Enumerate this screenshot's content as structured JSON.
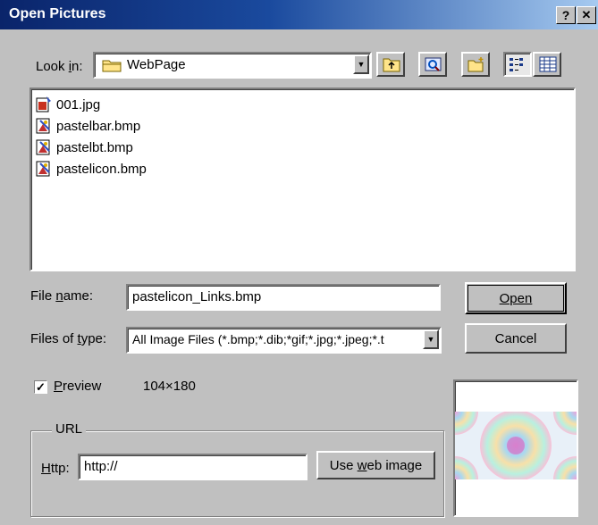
{
  "window": {
    "title": "Open Pictures",
    "help_label": "?",
    "close_label": "✕"
  },
  "lookin": {
    "label": "Look in:",
    "value": "WebPage"
  },
  "files": [
    {
      "name": "001.jpg",
      "icon": "jpg-file-icon"
    },
    {
      "name": "pastelbar.bmp",
      "icon": "bmp-file-icon"
    },
    {
      "name": "pastelbt.bmp",
      "icon": "bmp-file-icon"
    },
    {
      "name": "pastelicon.bmp",
      "icon": "bmp-file-icon"
    }
  ],
  "filename": {
    "label": "File name:",
    "value": "pastelicon_Links.bmp"
  },
  "filetype": {
    "label": "Files of type:",
    "value": "All Image Files (*.bmp;*.dib;*gif;*.jpg;*.jpeg;*.t"
  },
  "buttons": {
    "open": "Open",
    "cancel": "Cancel",
    "use_web_image": "Use web image"
  },
  "preview": {
    "label": "Preview",
    "checked": true,
    "dimensions": "104×180"
  },
  "url": {
    "group_label": "URL",
    "http_label": "Http:",
    "value": "http://"
  },
  "colors": {
    "title_start": "#0a246a",
    "title_end": "#a6caf0",
    "face": "#c0c0c0"
  }
}
